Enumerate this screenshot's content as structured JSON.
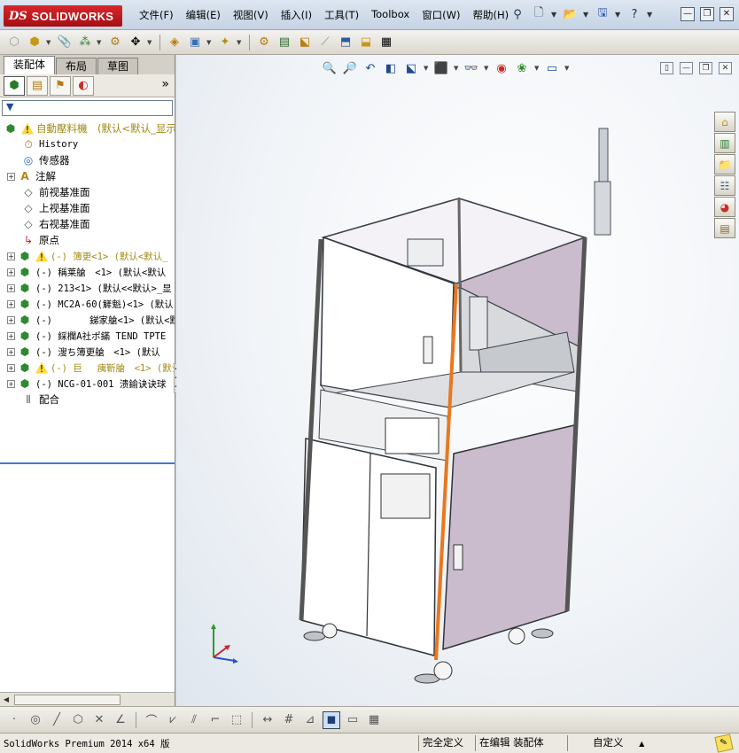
{
  "app": {
    "logo_ds": "DS",
    "logo_name": "SOLIDWORKS"
  },
  "menu": [
    "文件(F)",
    "编辑(E)",
    "视图(V)",
    "插入(I)",
    "工具(T)",
    "Toolbox",
    "窗口(W)",
    "帮助(H)"
  ],
  "panel": {
    "tabs": [
      "装配体",
      "布局",
      "草图"
    ],
    "active_tab": "装配体",
    "filter_glyph": "▼",
    "expand_glyph": "»"
  },
  "tree": {
    "root": "自動壓料機　(默认<默认_显示",
    "items": [
      {
        "label": "History",
        "mono": true
      },
      {
        "label": "传感器"
      },
      {
        "label": "注解"
      },
      {
        "label": "前视基准面"
      },
      {
        "label": "上视基准面"
      },
      {
        "label": "右视基准面"
      },
      {
        "label": "原点"
      },
      {
        "label": "(-) 簿更<1> (默认<默认_",
        "warn": true,
        "color": "#a18a12"
      },
      {
        "label": "(-) 稱莱艙　<1> (默认<默认"
      },
      {
        "label": "(-) 213<1> (默认<<默认>_显"
      },
      {
        "label": "(-) MC2A-60(觲魁)<1> (默认"
      },
      {
        "label": "(-)　　　　銻家艙<1> (默认<默认"
      },
      {
        "label": "(-) 綵欄A社ポ鏋 TEND TPTE"
      },
      {
        "label": "(-) 溲ち簿更艙　<1> (默认"
      },
      {
        "label": "(-) 巨　 痍靳艙　<1> (默认",
        "warn": true,
        "color": "#a18a12"
      },
      {
        "label": "(-) NCG-01-001 溃鍮诀诀球"
      },
      {
        "label": "配合"
      }
    ]
  },
  "status": {
    "version": "SolidWorks Premium 2014 x64 版",
    "fully_defined": "完全定义",
    "editing": "在编辑 装配体",
    "custom": "自定义",
    "custom_arrow": "▲"
  },
  "colors": {
    "panel_glass": "#cbbccd",
    "frame": "#9aa3ad",
    "orange_edge": "#e8781f",
    "tree_warning": "#a18a12"
  }
}
